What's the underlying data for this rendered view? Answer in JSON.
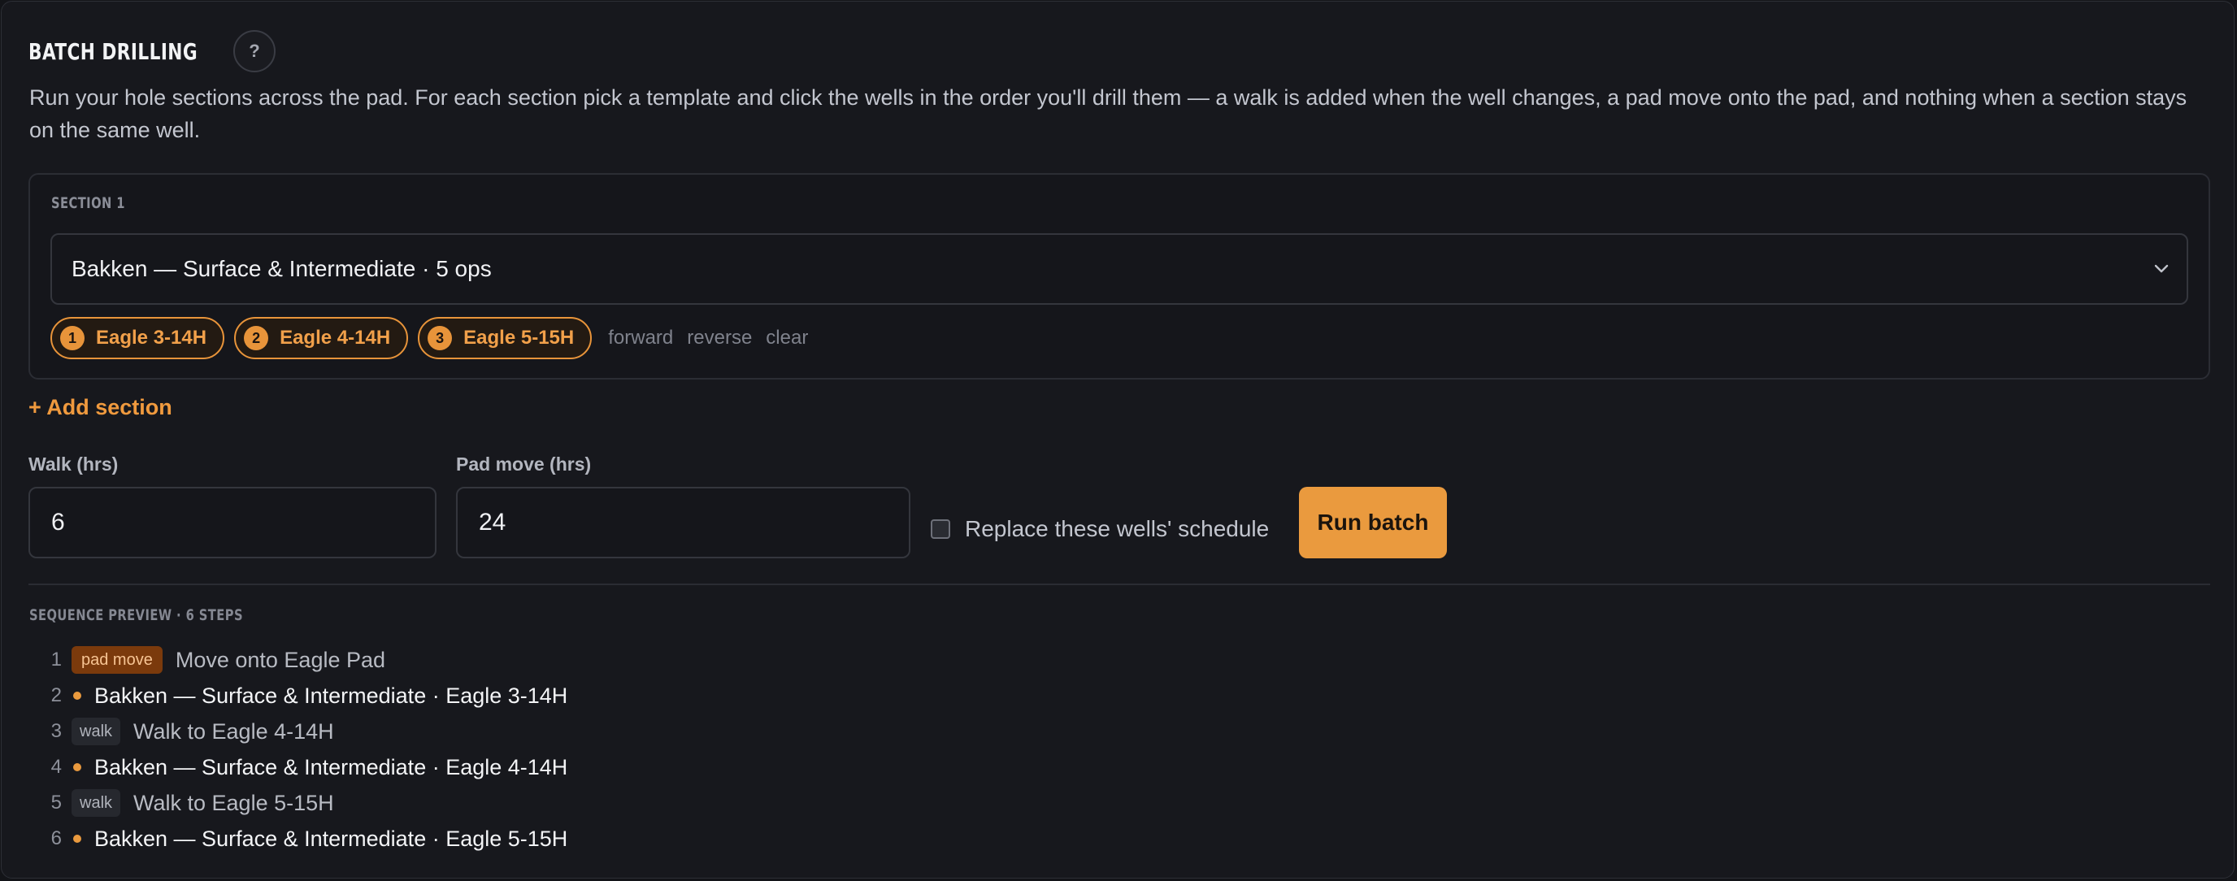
{
  "header": {
    "title": "BATCH DRILLING",
    "help_label": "?",
    "intro": "Run your hole sections across the pad. For each section pick a template and click the wells in the order you'll drill them — a walk is added when the well changes, a pad move onto the pad, and nothing when a section stays on the same well."
  },
  "sections": [
    {
      "label": "SECTION 1",
      "template": "Bakken — Surface & Intermediate · 5 ops",
      "wells": [
        {
          "order": "1",
          "name": "Eagle 3-14H"
        },
        {
          "order": "2",
          "name": "Eagle 4-14H"
        },
        {
          "order": "3",
          "name": "Eagle 5-15H"
        }
      ],
      "actions": {
        "forward": "forward",
        "reverse": "reverse",
        "clear": "clear"
      }
    }
  ],
  "add_section_label": "+ Add section",
  "walk": {
    "label": "Walk (hrs)",
    "value": "6"
  },
  "pad_move": {
    "label": "Pad move (hrs)",
    "value": "24"
  },
  "replace_schedule": {
    "label": "Replace these wells' schedule",
    "checked": false
  },
  "run_button_label": "Run batch",
  "preview": {
    "label": "SEQUENCE PREVIEW · 6 STEPS",
    "steps": [
      {
        "num": "1",
        "kind": "pad move",
        "text": "Move onto Eagle Pad"
      },
      {
        "num": "2",
        "kind": "op",
        "text": "Bakken — Surface & Intermediate · Eagle 3-14H"
      },
      {
        "num": "3",
        "kind": "walk",
        "text": "Walk to Eagle 4-14H"
      },
      {
        "num": "4",
        "kind": "op",
        "text": "Bakken — Surface & Intermediate · Eagle 4-14H"
      },
      {
        "num": "5",
        "kind": "walk",
        "text": "Walk to Eagle 5-15H"
      },
      {
        "num": "6",
        "kind": "op",
        "text": "Bakken — Surface & Intermediate · Eagle 5-15H"
      }
    ]
  },
  "colors": {
    "accent": "#ea9a3e",
    "background": "#17181d",
    "pad_move_badge": "#7b3a0c"
  },
  "icons": {
    "select_arrow": "chevron-down-icon",
    "step_marker": "dot-icon"
  }
}
